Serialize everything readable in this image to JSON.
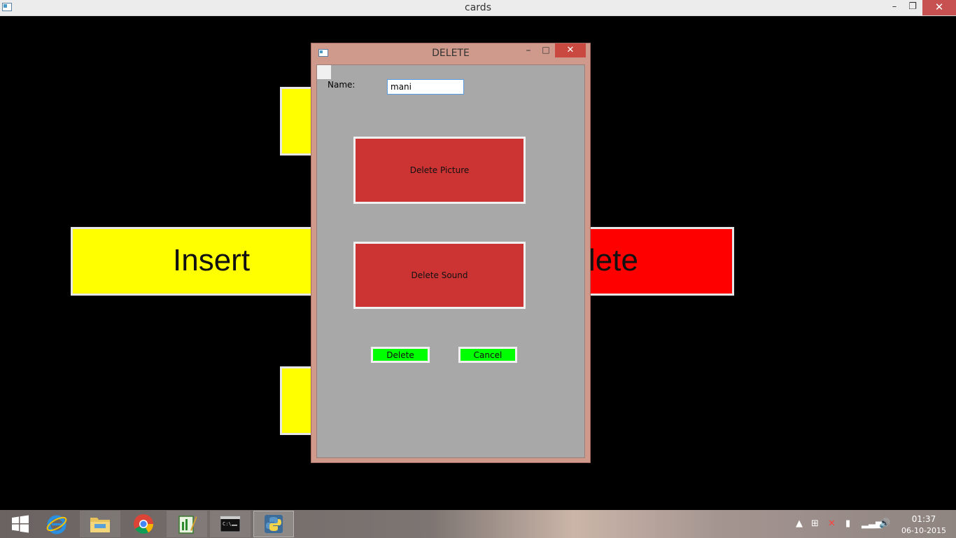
{
  "main_window": {
    "title": "cards",
    "controls": {
      "minimize": "–",
      "restore": "❐",
      "close": "✕"
    }
  },
  "cards": {
    "insert_label": "Insert",
    "delete_label": "lete"
  },
  "dialog": {
    "title": "DELETE",
    "controls": {
      "minimize": "–",
      "maximize": "□",
      "close": "✕"
    },
    "name_label": "Name:",
    "name_value": "mani",
    "delete_picture_label": "Delete Picture",
    "delete_sound_label": "Delete Sound",
    "delete_button": "Delete",
    "cancel_button": "Cancel"
  },
  "taskbar": {
    "apps": [
      "start-icon",
      "internet-explorer-icon",
      "file-explorer-icon",
      "chrome-icon",
      "editor-icon",
      "command-prompt-icon",
      "python-icon"
    ],
    "clock_time": "01:37",
    "clock_date": "06-10-2015"
  },
  "colors": {
    "card_yellow": "#ffff00",
    "card_red": "#ff0000",
    "dialog_frame": "#cf9a8b",
    "dialog_client": "#a8a8a8",
    "big_button": "#cc3333",
    "small_button": "#00ff00"
  }
}
